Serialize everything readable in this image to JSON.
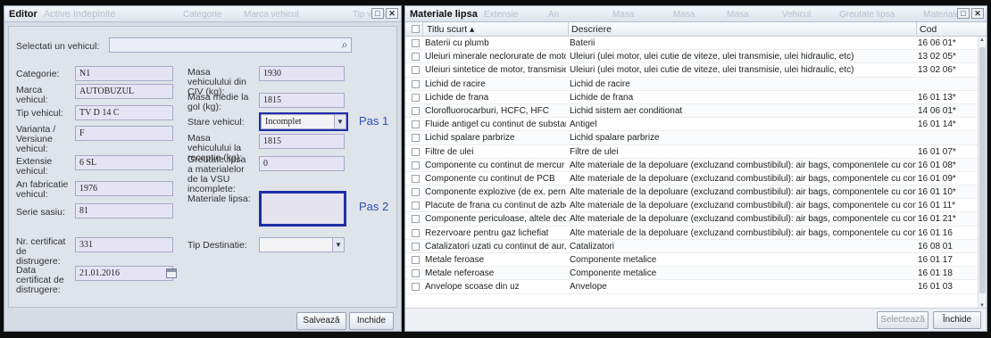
{
  "caption": "",
  "editor": {
    "title": "Editor",
    "ghost_title": "Active Indepinite",
    "ghost_cols": [
      "Categorie",
      "Marca vehicul",
      "Tip vehicul"
    ],
    "select_vehicle_label": "Selectati un vehicul:",
    "select_vehicle_value": "",
    "categorie_label": "Categorie:",
    "categorie_value": "N1",
    "marca_label": "Marca vehicul:",
    "marca_value": "AUTOBUZUL",
    "tip_label": "Tip vehicul:",
    "tip_value": "TV D 14 C",
    "varianta_label": "Varianta / Versiune vehicul:",
    "varianta_value": "F",
    "extensie_label": "Extensie vehicul:",
    "extensie_value": "6 SL",
    "an_label": "An fabricatie vehicul:",
    "an_value": "1976",
    "serie_label": "Serie sasiu:",
    "serie_value": "81",
    "nr_cert_label": "Nr. certificat de distrugere:",
    "nr_cert_value": "331",
    "data_cert_label": "Data certificat de distrugere:",
    "data_cert_value": "21.01.2016",
    "masa_civ_label": "Masa vehiculului din CIV (kg):",
    "masa_civ_value": "1930",
    "masa_medie_label": "Masa medie la gol (kg):",
    "masa_medie_value": "1815",
    "stare_label": "Stare vehicul:",
    "stare_value": "Incomplet",
    "masa_receptie_label": "Masa vehiculului la receptie (kg):",
    "masa_receptie_value": "1815",
    "greutate_label": "Greutate lipsa a materialelor de la VSU incomplete:",
    "greutate_value": "0",
    "materiale_label": "Materiale lipsa:",
    "tip_dest_label": "Tip Destinatie:",
    "tip_dest_value": "",
    "pas1": "Pas 1",
    "pas2": "Pas 2",
    "save_label": "Salvează",
    "close_label": "Inchide"
  },
  "materials": {
    "title": "Materiale lipsa",
    "ghost_cols": [
      "Extensie",
      "An",
      "Masa",
      "Masa",
      "Masa",
      "Vehicul",
      "Greutate lipsa",
      "Materiale"
    ],
    "col_title": "Titlu scurt",
    "col_desc": "Descriere",
    "col_code": "Cod",
    "rows": [
      {
        "title": "Baterii cu plumb",
        "desc": "Baterii",
        "code": "16 06 01*"
      },
      {
        "title": "Uleiuri minerale neclorurate de motor, de",
        "desc": "Uleiuri (ulei motor, ulei cutie de viteze, ulei transmisie, ulei hidraulic, etc)",
        "code": "13 02 05*"
      },
      {
        "title": "Uleiuri sintetice de motor, transmisie si c",
        "desc": "Uleiuri (ulei motor, ulei cutie de viteze, ulei transmisie, ulei hidraulic, etc)",
        "code": "13 02 06*"
      },
      {
        "title": "Lichid de racire",
        "desc": "Lichid de racire",
        "code": ""
      },
      {
        "title": "Lichide de frana",
        "desc": "Lichide de frana",
        "code": "16 01 13*"
      },
      {
        "title": "Clorofluorocarburi, HCFC, HFC",
        "desc": "Lichid sistem aer conditionat",
        "code": "14 06 01*"
      },
      {
        "title": "Fluide antigel cu continut de substante p",
        "desc": "Antigel",
        "code": "16 01 14*"
      },
      {
        "title": "Lichid spalare parbrize",
        "desc": "Lichid spalare parbrize",
        "code": ""
      },
      {
        "title": "Filtre de ulei",
        "desc": "Filtre de ulei",
        "code": "16 01 07*"
      },
      {
        "title": "Componente cu continut de mercur",
        "desc": "Alte materiale de la depoluare (excluzand combustibilul): air bags, componentele cu continut de me",
        "code": "16 01 08*"
      },
      {
        "title": "Componente cu continut de PCB",
        "desc": "Alte materiale de la depoluare (excluzand combustibilul): air bags, componentele cu continut de me",
        "code": "16 01 09*"
      },
      {
        "title": "Componente explozive (de ex. perne de",
        "desc": "Alte materiale de la depoluare (excluzand combustibilul): air bags, componentele cu continut de me",
        "code": "16 01 10*"
      },
      {
        "title": "Placute de frana cu continut de azbest",
        "desc": "Alte materiale de la depoluare (excluzand combustibilul): air bags, componentele cu continut de me",
        "code": "16 01 11*"
      },
      {
        "title": "Componente periculoase, altele decat ce",
        "desc": "Alte materiale de la depoluare (excluzand combustibilul): air bags, componentele cu continut de me",
        "code": "16 01 21*"
      },
      {
        "title": "Rezervoare pentru gaz lichefiat",
        "desc": "Alte materiale de la depoluare (excluzand combustibilul): air bags, componentele cu continut de me",
        "code": "16 01 16"
      },
      {
        "title": "Catalizatori uzati cu continut de aur, arg",
        "desc": "Catalizatori",
        "code": "16 08 01"
      },
      {
        "title": "Metale feroase",
        "desc": "Componente metalice",
        "code": "16 01 17"
      },
      {
        "title": "Metale neferoase",
        "desc": "Componente metalice",
        "code": "16 01 18"
      },
      {
        "title": "Anvelope scoase din uz",
        "desc": "Anvelope",
        "code": "16 01 03"
      }
    ],
    "select_label": "Selectează",
    "close_label": "Închide"
  }
}
